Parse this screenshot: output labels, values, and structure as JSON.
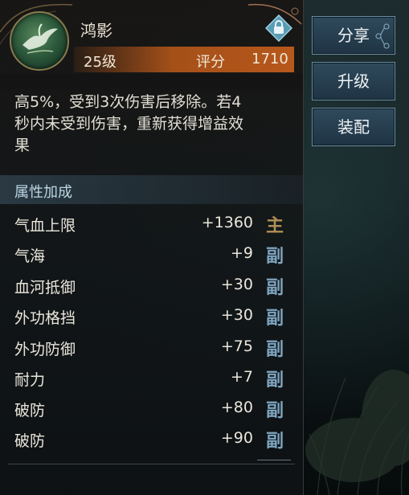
{
  "item": {
    "name": "鸿影",
    "level": "25级",
    "rating_label": "评分",
    "rating_value": "1710",
    "icon": "crane-emblem-icon"
  },
  "description": {
    "line1": "高5%，受到3次伤害后移除。若4",
    "line2": "秒内未受到伤害，重新获得增益效",
    "line3": "果"
  },
  "attributes_section": {
    "title": "属性加成",
    "rows": [
      {
        "name": "气血上限",
        "value": "+1360",
        "tag": "主"
      },
      {
        "name": "气海",
        "value": "+9",
        "tag": "副"
      },
      {
        "name": "血河抵御",
        "value": "+30",
        "tag": "副"
      },
      {
        "name": "外功格挡",
        "value": "+30",
        "tag": "副"
      },
      {
        "name": "外功防御",
        "value": "+75",
        "tag": "副"
      },
      {
        "name": "耐力",
        "value": "+7",
        "tag": "副"
      },
      {
        "name": "破防",
        "value": "+80",
        "tag": "副"
      },
      {
        "name": "破防",
        "value": "+90",
        "tag": "副"
      }
    ]
  },
  "actions": {
    "share": "分享",
    "upgrade": "升级",
    "equip": "装配"
  },
  "colors": {
    "rating_bar": "#c85f1c",
    "main_tag": "#b09055",
    "sub_tag": "#7ea4c0",
    "button_border": "#6a8ea4"
  }
}
